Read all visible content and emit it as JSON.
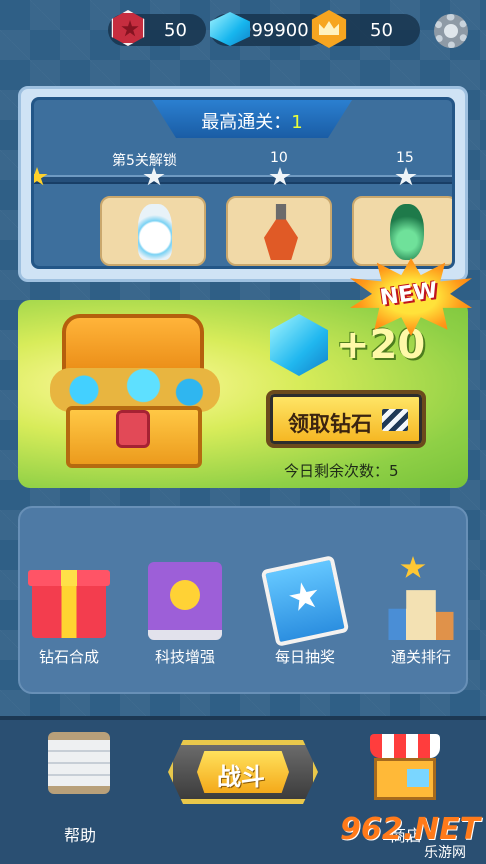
{
  "topbar": {
    "star_count": "50",
    "gem_count": "999900",
    "crown_count": "50",
    "icons": [
      "star-badge-icon",
      "gem-icon",
      "crown-icon",
      "settings-gear-icon"
    ]
  },
  "progress": {
    "best_label": "最高通关：",
    "best_value": "1",
    "milestone_1": "第5关解锁",
    "milestone_2": "10",
    "milestone_3": "15",
    "units": [
      "white-tower-unit",
      "orange-cannon-unit",
      "green-tank-unit"
    ]
  },
  "treasure": {
    "badge": "NEW",
    "reward": "+20",
    "claim_label": "领取钻石",
    "remaining": "今日剩余次数：5"
  },
  "features": [
    {
      "label": "钻石合成",
      "icon": "gift-box-icon"
    },
    {
      "label": "科技增强",
      "icon": "tech-book-icon"
    },
    {
      "label": "每日抽奖",
      "icon": "lottery-cards-icon"
    },
    {
      "label": "通关排行",
      "icon": "podium-icon"
    }
  ],
  "bottom_nav": {
    "help_label": "帮助",
    "battle_label": "战斗",
    "shop_label": "商店"
  },
  "watermark": {
    "logo": "962.NET",
    "sub": "乐游网"
  },
  "colors": {
    "background": "#2f5f86",
    "treasure_green": "#8fd046",
    "gold_button": "#f5b41f",
    "highlight_yellow": "#e9ff3a"
  }
}
